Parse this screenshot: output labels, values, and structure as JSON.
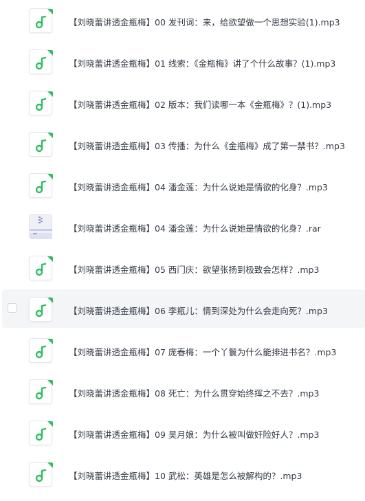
{
  "files": [
    {
      "name": "【刘晓蕾讲透金瓶梅】00 发刊词：来，给欲望做一个思想实验(1).mp3",
      "icon": "music-note-icon"
    },
    {
      "name": "【刘晓蕾讲透金瓶梅】01 线索：《金瓶梅》讲了个什么故事？(1).mp3",
      "icon": "music-note-icon"
    },
    {
      "name": "【刘晓蕾讲透金瓶梅】02 版本：我们读哪一本《金瓶梅》？(1).mp3",
      "icon": "music-note-icon"
    },
    {
      "name": "【刘晓蕾讲透金瓶梅】03 传播：为什么《金瓶梅》成了第一禁书？.mp3",
      "icon": "music-note-icon"
    },
    {
      "name": "【刘晓蕾讲透金瓶梅】04 潘金莲：为什么说她是情欲的化身？.mp3",
      "icon": "music-note-icon"
    },
    {
      "name": "【刘晓蕾讲透金瓶梅】04 潘金莲：为什么说她是情欲的化身？.rar",
      "icon": "archive-icon"
    },
    {
      "name": "【刘晓蕾讲透金瓶梅】05 西门庆：欲望张扬到极致会怎样？.mp3",
      "icon": "music-note-icon"
    },
    {
      "name": "【刘晓蕾讲透金瓶梅】06 李瓶儿：情到深处为什么会走向死？.mp3",
      "icon": "music-note-icon"
    },
    {
      "name": "【刘晓蕾讲透金瓶梅】07 庞春梅：一个丫鬟为什么能排进书名？.mp3",
      "icon": "music-note-icon"
    },
    {
      "name": "【刘晓蕾讲透金瓶梅】08 死亡：为什么贯穿始终挥之不去？.mp3",
      "icon": "music-note-icon"
    },
    {
      "name": "【刘晓蕾讲透金瓶梅】09 吴月娘：为什么被叫做奸险好人？.mp3",
      "icon": "music-note-icon"
    },
    {
      "name": "【刘晓蕾讲透金瓶梅】10 武松：英雄是怎么被解构的？.mp3",
      "icon": "music-note-icon"
    }
  ],
  "colors": {
    "audio_green": "#2fbd63",
    "archive_blue": "#6f7fb8",
    "hover_bg": "#f4f5f7",
    "text": "#333a45"
  }
}
